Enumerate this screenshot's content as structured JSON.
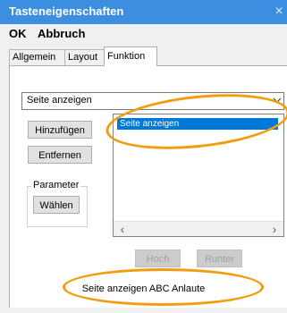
{
  "window": {
    "title": "Tasteneigenschaften",
    "close_glyph": "×"
  },
  "menu": {
    "ok": "OK",
    "abbruch": "Abbruch"
  },
  "tabs": [
    {
      "label": "Allgemein",
      "active": false
    },
    {
      "label": "Layout",
      "active": false
    },
    {
      "label": "Funktion",
      "active": true
    }
  ],
  "function_select": {
    "value": "Seite anzeigen"
  },
  "buttons": {
    "add": "Hinzufügen",
    "remove": "Entfernen",
    "choose": "Wählen",
    "up": "Hoch",
    "down": "Runter"
  },
  "parameter_group": {
    "label": "Parameter"
  },
  "listbox": {
    "items": [
      "Seite anzeigen"
    ]
  },
  "scroll": {
    "left": "‹",
    "right": "›"
  },
  "summary": {
    "text": "Seite anzeigen ABC Anlaute"
  },
  "colors": {
    "titlebar": "#3c8fe0",
    "selection": "#0078d7",
    "annotation": "#f39c12"
  }
}
